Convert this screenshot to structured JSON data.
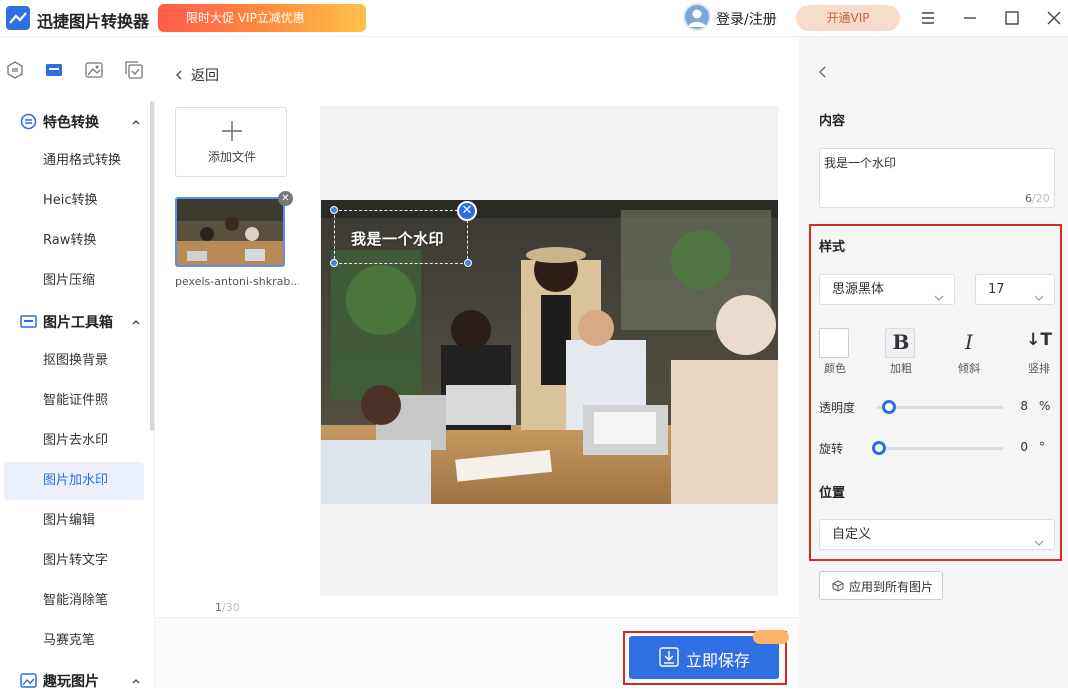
{
  "app": {
    "title": "迅捷图片转换器",
    "vip_banner": "限时大促 VIP立减优惠",
    "login": "登录/注册",
    "vip_pill": "开通VIP"
  },
  "sidebar": {
    "sections": [
      {
        "title": "特色转换",
        "items": [
          "通用格式转换",
          "Heic转换",
          "Raw转换",
          "图片压缩"
        ]
      },
      {
        "title": "图片工具箱",
        "items": [
          "抠图换背景",
          "智能证件照",
          "图片去水印",
          "图片加水印",
          "图片编辑",
          "图片转文字",
          "智能消除笔",
          "马赛克笔"
        ]
      },
      {
        "title": "趣玩图片",
        "items": []
      }
    ],
    "active_item": "图片加水印"
  },
  "main": {
    "back": "返回",
    "add_file": "添加文件",
    "thumb_name": "pexels-antoni-shkrab...",
    "page_current": "1",
    "page_total": "/30",
    "watermark_text": "我是一个水印",
    "save": "立即保存"
  },
  "panel": {
    "content_label": "内容",
    "content_value": "我是一个水印",
    "count_current": "6",
    "count_max": "/20",
    "style_label": "样式",
    "font": "思源黑体",
    "size": "17",
    "tools": [
      {
        "glyph": "",
        "label": "颜色"
      },
      {
        "glyph": "B",
        "label": "加粗"
      },
      {
        "glyph": "I",
        "label": "倾斜"
      },
      {
        "glyph": "↓T",
        "label": "竖排"
      }
    ],
    "opacity_label": "透明度",
    "opacity_value": "8",
    "opacity_unit": "%",
    "rotation_label": "旋转",
    "rotation_value": "0",
    "rotation_unit": "°",
    "position_label": "位置",
    "position_value": "自定义",
    "apply_all": "应用到所有图片"
  },
  "colors": {
    "accent": "#2c6de3",
    "highlight": "#d42a2a"
  }
}
